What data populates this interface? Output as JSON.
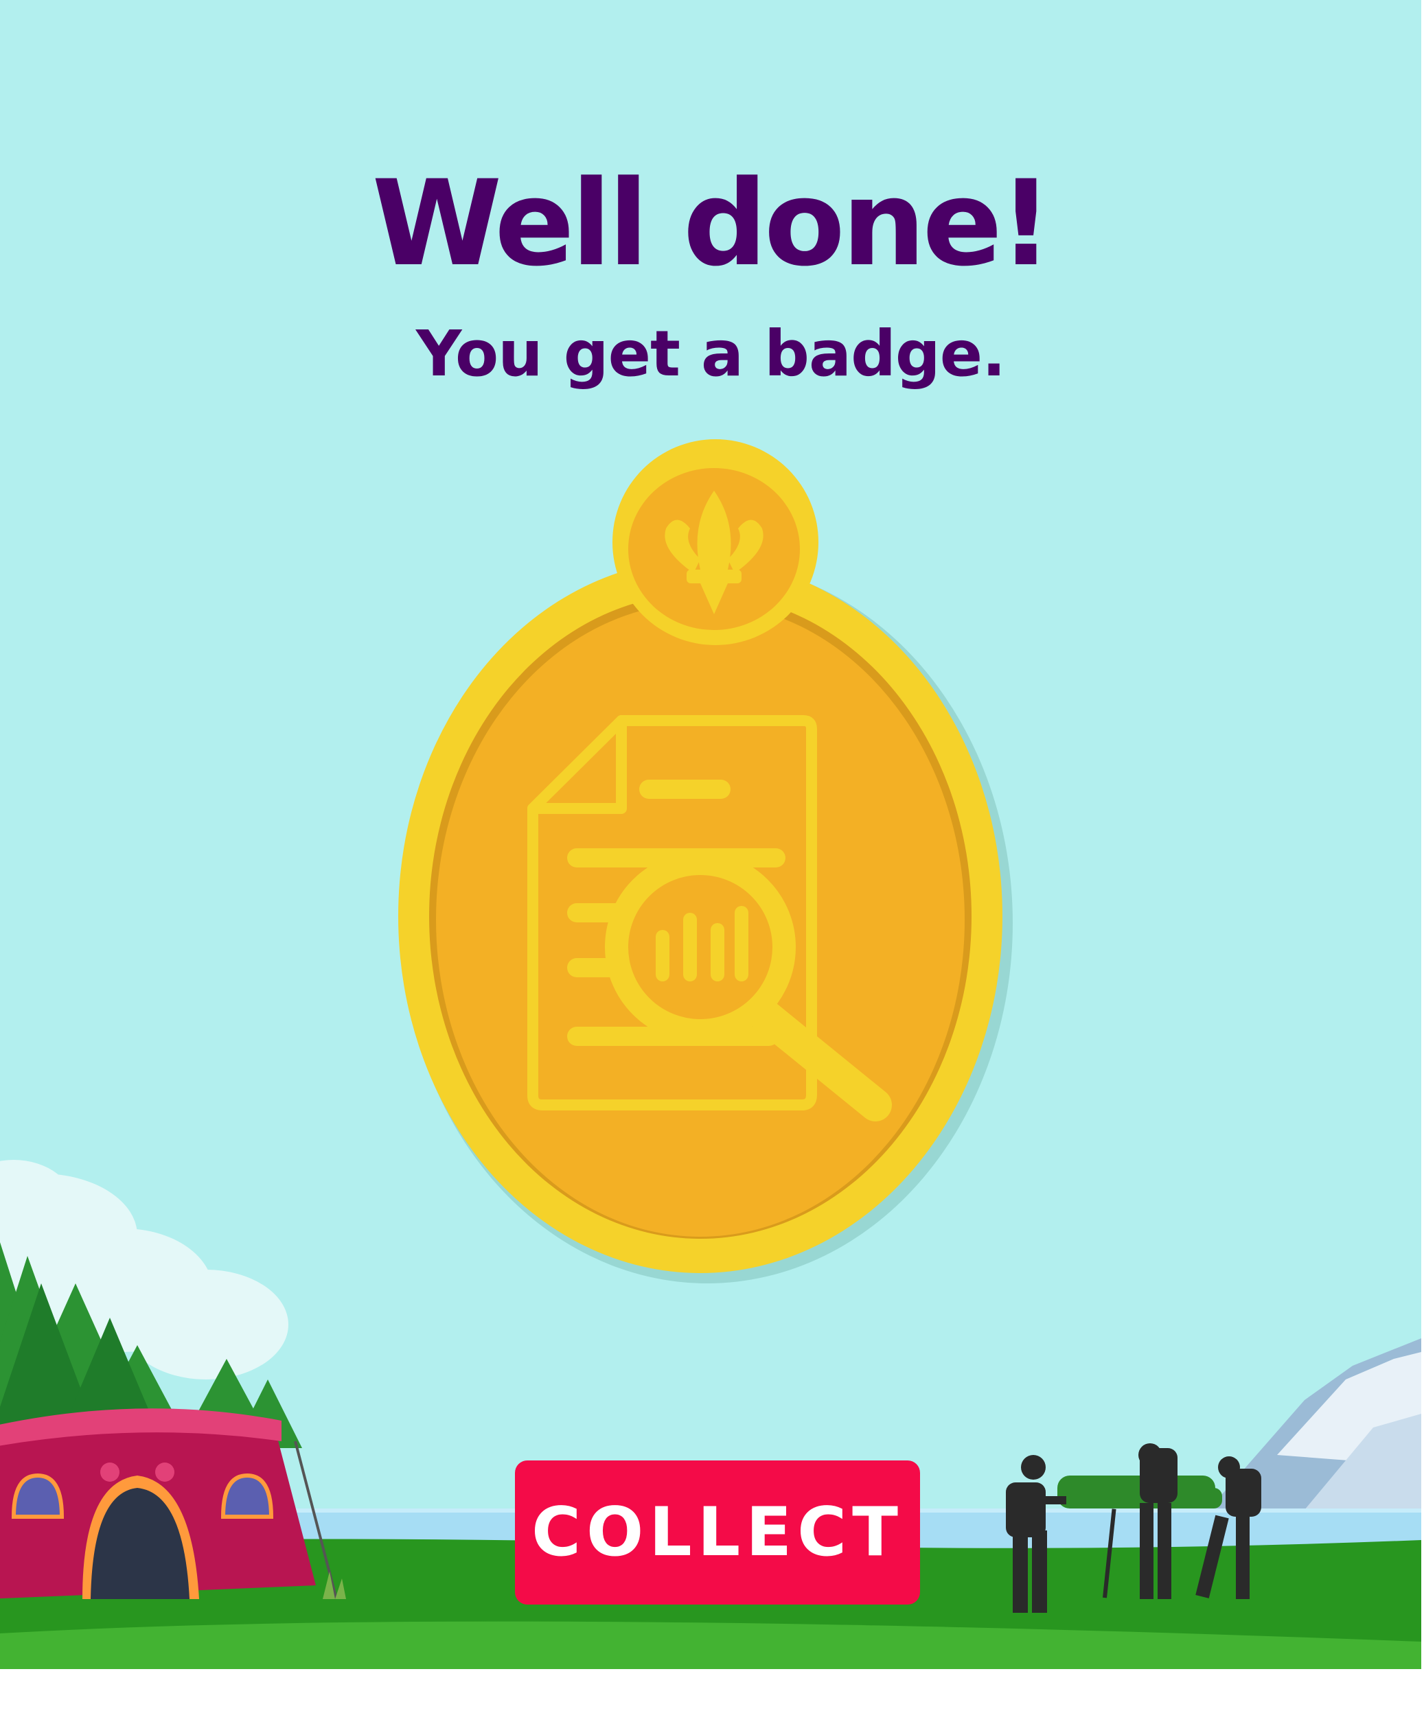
{
  "message": {
    "headline": "Well done!",
    "subline": "You get a badge."
  },
  "actions": {
    "collect_label": "COLLECT"
  },
  "colors": {
    "sky": "#b2efee",
    "heading": "#4a0066",
    "badge_rim": "#f5d22a",
    "badge_face": "#f3b025",
    "collect_button": "#f40b48",
    "tent": "#c81a56",
    "grass": "#28961f",
    "lake": "#a6ddf4",
    "hikers": "#2a2a2a"
  },
  "icons": {
    "badge_emblem": "fleur-de-lis-icon",
    "badge_symbol": "document-search-chart-icon"
  }
}
